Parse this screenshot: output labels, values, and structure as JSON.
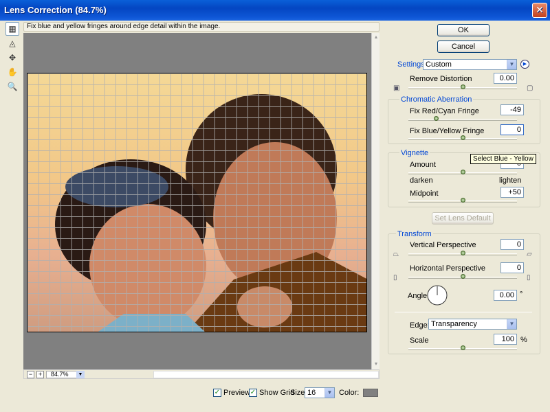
{
  "window": {
    "title": "Lens Correction (84.7%)",
    "close_label": "✕"
  },
  "hint": "Fix blue and yellow fringes around edge detail within the image.",
  "zoom": {
    "value": "84.7%",
    "minus": "−",
    "plus": "+"
  },
  "buttons": {
    "ok": "OK",
    "cancel": "Cancel",
    "set_lens_default": "Set Lens Default"
  },
  "settings": {
    "label": "Settings:",
    "value": "Custom"
  },
  "remove_distortion": {
    "label": "Remove Distortion",
    "value": "0.00",
    "slider_pct": 50
  },
  "chromatic": {
    "title": "Chromatic Aberration",
    "red_cyan": {
      "label": "Fix Red/Cyan Fringe",
      "value": "-49",
      "slider_pct": 25
    },
    "blue_yellow": {
      "label": "Fix Blue/Yellow Fringe",
      "value": "0",
      "slider_pct": 50
    }
  },
  "tooltip": "Select Blue - Yellow",
  "vignette": {
    "title": "Vignette",
    "amount": {
      "label": "Amount",
      "value": "0",
      "slider_pct": 50
    },
    "darken": "darken",
    "lighten": "lighten",
    "midpoint": {
      "label": "Midpoint",
      "value": "+50",
      "slider_pct": 50
    }
  },
  "transform": {
    "title": "Transform",
    "vertical": {
      "label": "Vertical Perspective",
      "value": "0",
      "slider_pct": 50
    },
    "horizontal": {
      "label": "Horizontal Perspective",
      "value": "0",
      "slider_pct": 50
    },
    "angle": {
      "label": "Angle:",
      "value": "0.00",
      "unit": "°"
    },
    "edge": {
      "label": "Edge:",
      "value": "Transparency"
    },
    "scale": {
      "label": "Scale",
      "value": "100",
      "unit": "%",
      "slider_pct": 50
    }
  },
  "footer": {
    "preview": "Preview",
    "show_grid": "Show Grid",
    "size_label": "Size:",
    "size_value": "16",
    "color_label": "Color:",
    "grid_color": "#808080"
  }
}
